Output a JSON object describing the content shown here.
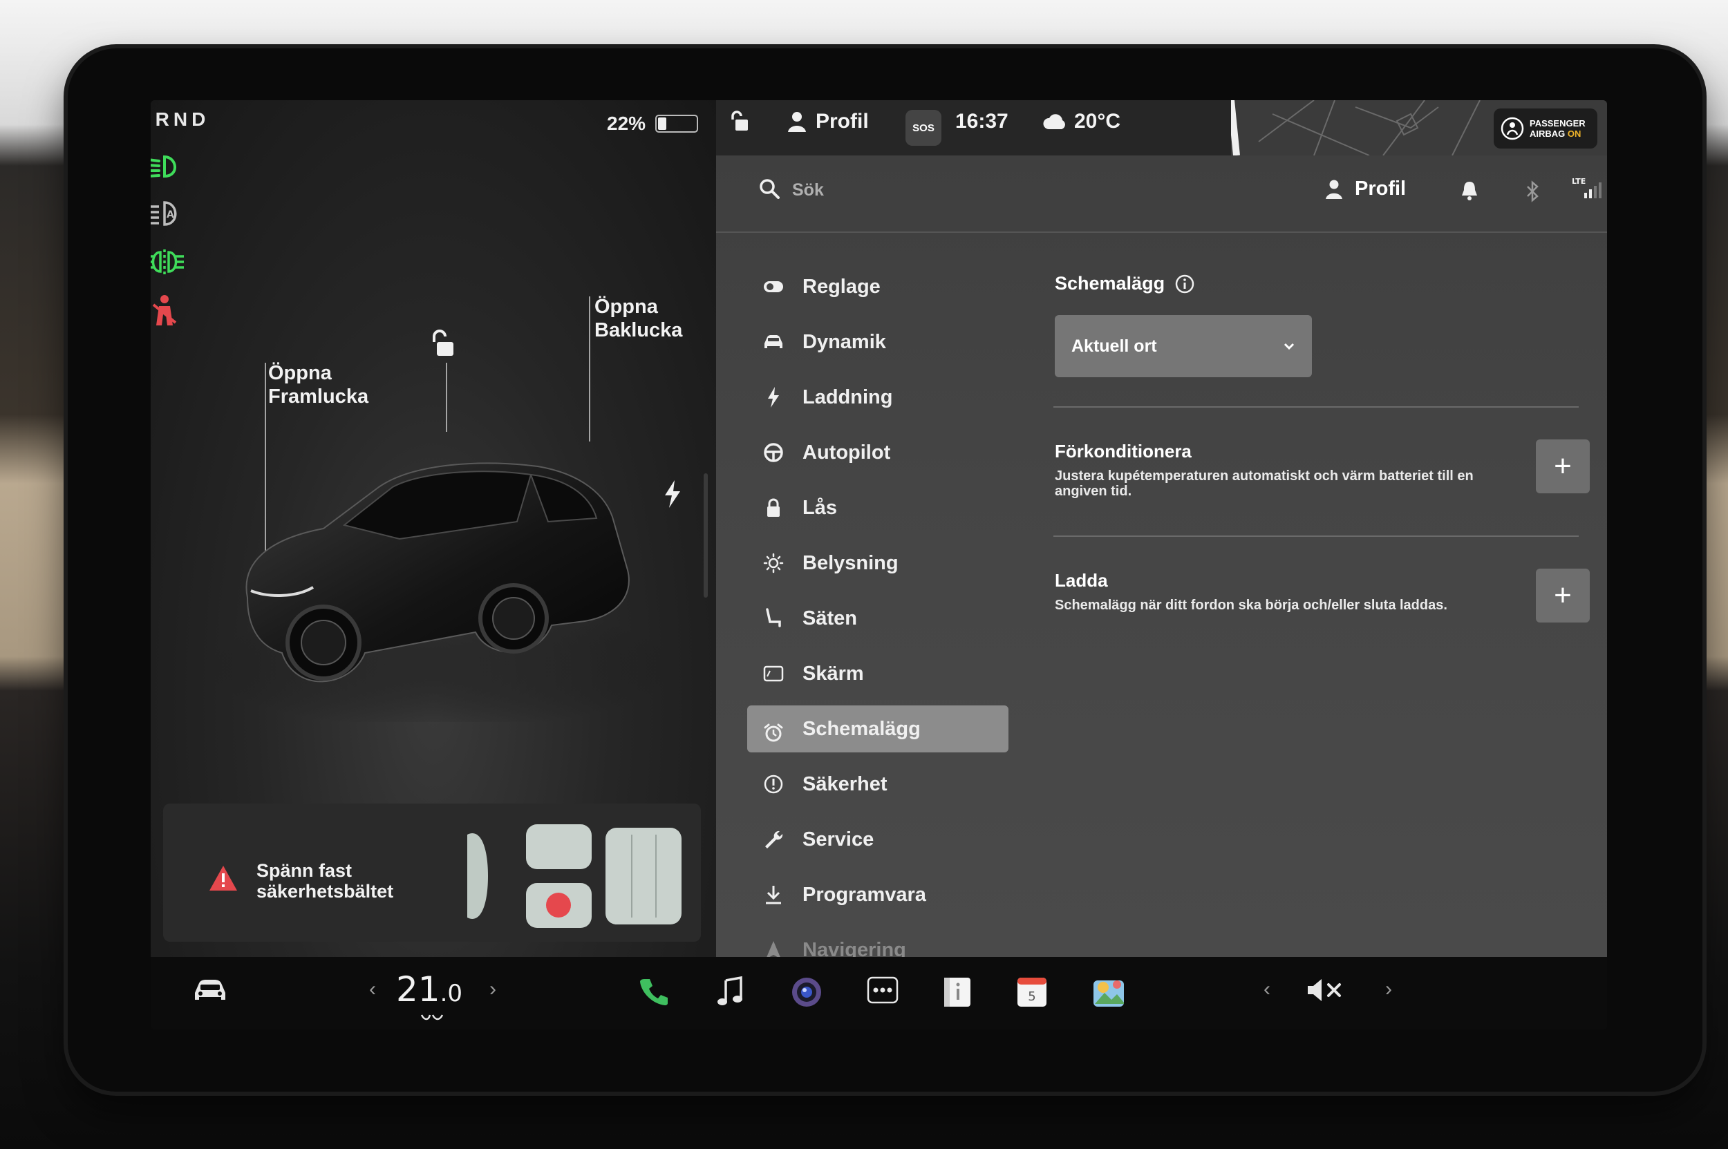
{
  "left_panel": {
    "gear": "PRND",
    "battery_percent": "22%",
    "battery_level": 0.22,
    "callouts": {
      "frunk": "Öppna\nFramlucka",
      "trunk": "Öppna\nBaklucka"
    },
    "seatbelt_alert": "Spänn fast säkerhetsbältet",
    "telltales": [
      "low-beam-icon",
      "auto-high-beam-icon",
      "fog-light-icon",
      "seatbelt-warning-icon"
    ]
  },
  "status_bar": {
    "profile_label": "Profil",
    "sos_label": "SOS",
    "time": "16:37",
    "temperature": "20°C",
    "airbag_line1": "PASSENGER",
    "airbag_line2": "AIRBAG",
    "airbag_state": "ON"
  },
  "search": {
    "placeholder": "Sök",
    "profile_label": "Profil",
    "lte_label": "LTE"
  },
  "menu": {
    "items": [
      {
        "label": "Reglage",
        "icon": "toggle-icon"
      },
      {
        "label": "Dynamik",
        "icon": "car-icon"
      },
      {
        "label": "Laddning",
        "icon": "bolt-icon"
      },
      {
        "label": "Autopilot",
        "icon": "steering-wheel-icon"
      },
      {
        "label": "Lås",
        "icon": "lock-icon"
      },
      {
        "label": "Belysning",
        "icon": "sun-icon"
      },
      {
        "label": "Säten",
        "icon": "seat-icon"
      },
      {
        "label": "Skärm",
        "icon": "display-icon"
      },
      {
        "label": "Schemalägg",
        "icon": "alarm-clock-icon",
        "active": true
      },
      {
        "label": "Säkerhet",
        "icon": "info-circle-icon"
      },
      {
        "label": "Service",
        "icon": "wrench-icon"
      },
      {
        "label": "Programvara",
        "icon": "download-icon"
      },
      {
        "label": "Navigering",
        "icon": "navigation-icon"
      }
    ]
  },
  "schedule": {
    "title": "Schemalägg",
    "location_value": "Aktuell ort",
    "precondition_title": "Förkonditionera",
    "precondition_desc": "Justera kupétemperaturen automatiskt och värm batteriet till en angiven tid.",
    "charge_title": "Ladda",
    "charge_desc": "Schemalägg när ditt fordon ska börja och/eller sluta laddas."
  },
  "taskbar": {
    "temp_int": "21",
    "temp_dec": ".0",
    "calendar_day": "5",
    "colors": {
      "phone": "#3fbf5f",
      "calendar": "#e74c3c"
    }
  }
}
